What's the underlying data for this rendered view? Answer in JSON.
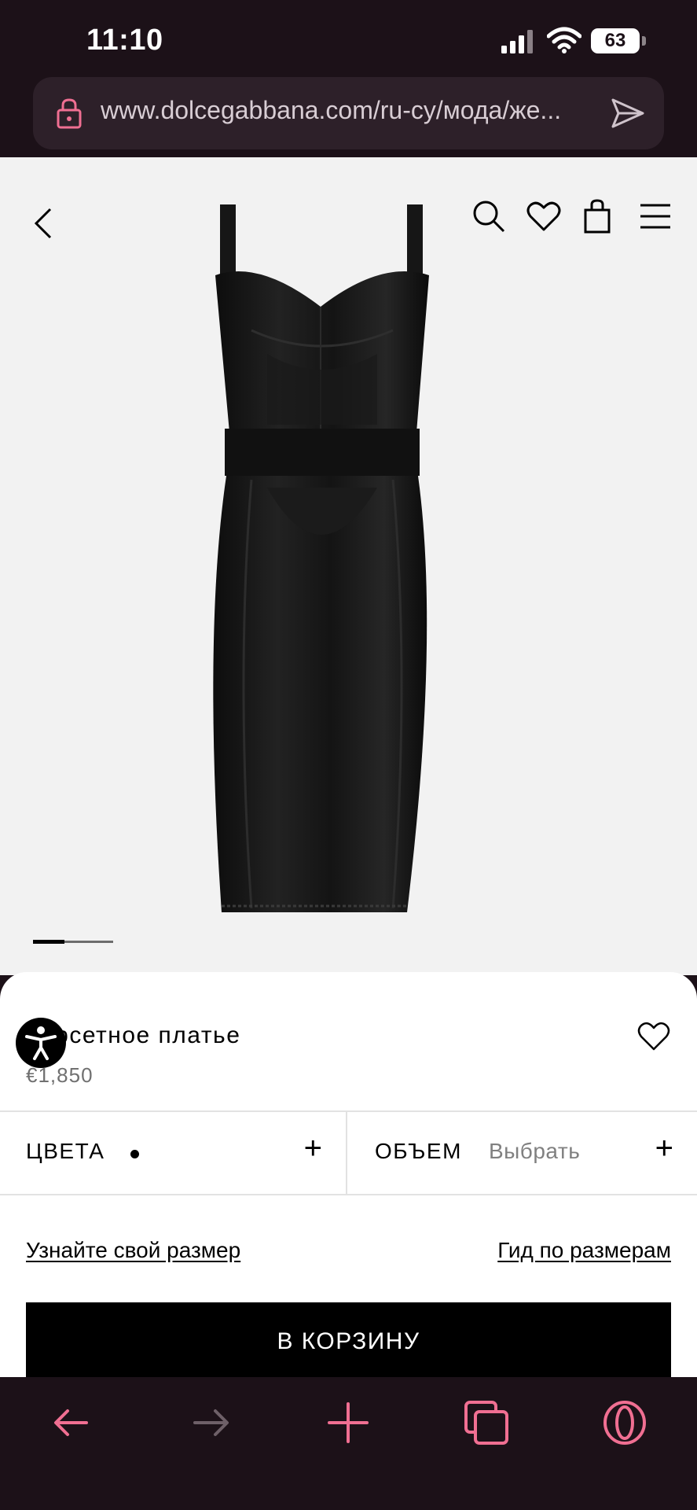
{
  "status_bar": {
    "time": "11:10",
    "battery_level": "63"
  },
  "browser": {
    "url": "www.dolcegabbana.com/ru-cy/мода/же...",
    "accent_color": "#f06f92"
  },
  "gallery": {
    "image_index": 1,
    "image_count": 3
  },
  "product": {
    "title": "Корсетное платье",
    "price": "€1,850",
    "options": {
      "color_label": "ЦВЕТА",
      "volume_label": "ОБЪЕМ",
      "volume_value": "Выбрать",
      "plus": "+"
    },
    "find_size_link": "Узнайте свой размер",
    "size_guide_link": "Гид по размерам",
    "add_to_cart": "В КОРЗИНУ"
  },
  "icons": {
    "header": [
      "search-icon",
      "heart-icon",
      "bag-icon",
      "menu-icon"
    ],
    "toolbar": [
      "back-arrow-icon",
      "forward-arrow-icon",
      "plus-icon",
      "tabs-icon",
      "opera-icon"
    ]
  }
}
